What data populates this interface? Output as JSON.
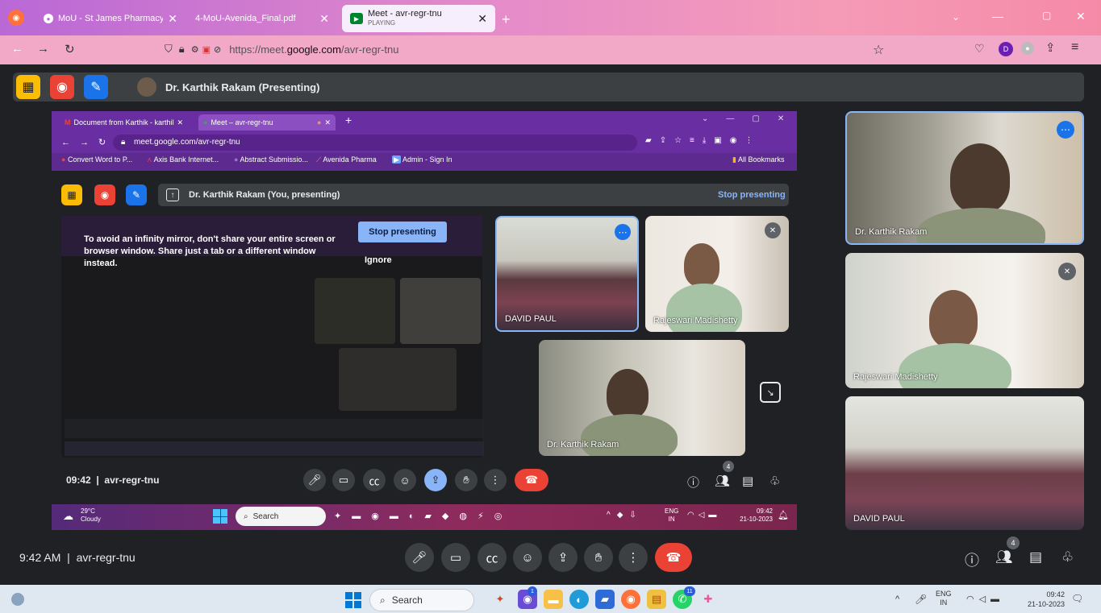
{
  "browser": {
    "tabs": [
      {
        "label": "MoU - St James Pharmacy Colle",
        "active": false
      },
      {
        "label": "4-MoU-Avenida_Final.pdf",
        "active": false
      },
      {
        "label": "Meet - avr-regr-tnu",
        "sublabel": "PLAYING",
        "active": true
      }
    ],
    "url_prefix": "https://meet.",
    "url_domain": "google.com",
    "url_path": "/avr-regr-tnu"
  },
  "meet": {
    "presenter_banner": "Dr. Karthik Rakam (Presenting)",
    "time": "9:42 AM",
    "meeting_code": "avr-regr-tnu",
    "participant_count": "4"
  },
  "shared_screen": {
    "tabs": [
      {
        "label": "Document from Karthik - karthil"
      },
      {
        "label": "Meet – avr-regr-tnu"
      }
    ],
    "url": "meet.google.com/avr-regr-tnu",
    "bookmarks": [
      "Convert Word to P...",
      "Axis Bank Internet...",
      "Abstract Submissio...",
      "Avenida Pharma",
      "Admin - Sign In"
    ],
    "all_bookmarks": "All Bookmarks",
    "presenting_banner": "Dr. Karthik Rakam (You, presenting)",
    "stop_presenting_link": "Stop presenting",
    "warning_text": "To avoid an infinity mirror, don't share your entire screen or browser window. Share just a tab or a different window instead.",
    "stop_presenting_button": "Stop presenting",
    "ignore_button": "Ignore",
    "time": "09:42",
    "meeting_code": "avr-regr-tnu",
    "participant_count": "4",
    "tiles": [
      "DAVID PAUL",
      "Rajeswari Madishetty",
      "Dr. Karthik Rakam"
    ],
    "taskbar": {
      "temp": "29°C",
      "weather": "Cloudy",
      "search": "Search",
      "lang": "ENG",
      "region": "IN",
      "clock": "09:42",
      "date": "21-10-2023"
    }
  },
  "sidebar_tiles": [
    "Dr. Karthik Rakam",
    "Rajeswari Madishetty",
    "DAVID PAUL"
  ],
  "taskbar": {
    "search": "Search",
    "lang": "ENG",
    "region": "IN",
    "clock": "09:42",
    "date": "21-10-2023",
    "badge_chrome": "1",
    "badge_whatsapp": "11"
  },
  "colors": {
    "end_call": "#ea4335",
    "accent_blue": "#8ab4f8",
    "present_blue": "#8ab4f8"
  }
}
